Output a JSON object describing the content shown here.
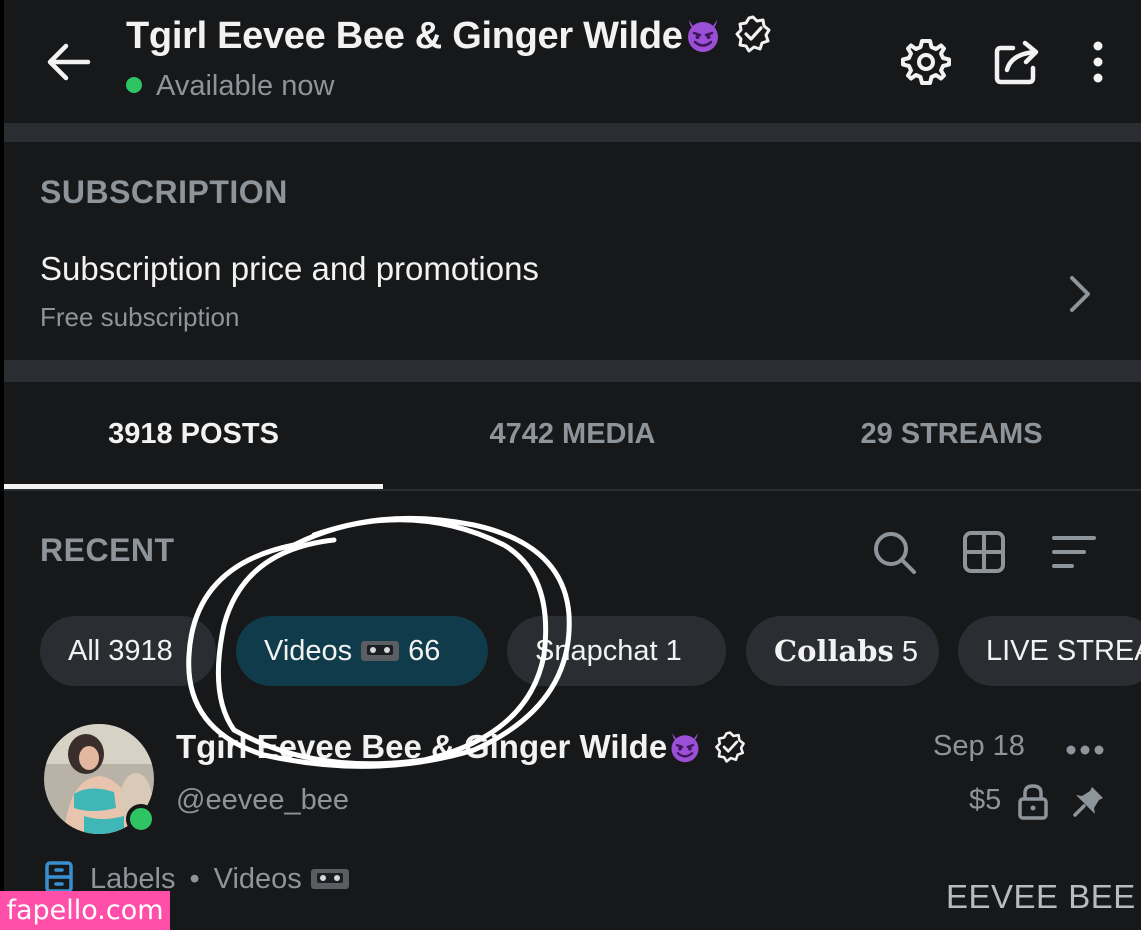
{
  "header": {
    "title": "Tgirl Eevee Bee & Ginger Wilde",
    "status": "Available now",
    "icons": [
      "back-arrow-icon",
      "devil-emoji-icon",
      "verified-badge-icon",
      "settings-gear-icon",
      "share-icon",
      "more-vertical-icon"
    ]
  },
  "subscription": {
    "heading": "SUBSCRIPTION",
    "price_label": "Subscription price and promotions",
    "price_value": "Free subscription"
  },
  "tabs": [
    {
      "label": "3918 POSTS",
      "active": true
    },
    {
      "label": "4742 MEDIA",
      "active": false
    },
    {
      "label": "29 STREAMS",
      "active": false
    }
  ],
  "recent": {
    "heading": "RECENT",
    "icons": [
      "search-icon",
      "grid-icon",
      "sort-icon"
    ]
  },
  "chips": [
    {
      "label": "All 3918",
      "active": false
    },
    {
      "label": "Videos",
      "count": "66",
      "active": true
    },
    {
      "label": "Snapchat 1",
      "active": false
    },
    {
      "label": "Collabs",
      "count": "5",
      "active": false
    },
    {
      "label": "LIVE STREA",
      "active": false
    }
  ],
  "post": {
    "name": "Tgirl Eevee Bee & Ginger Wilde",
    "handle": "@eevee_bee",
    "date": "Sep 18",
    "price": "$5",
    "labels_label": "Labels",
    "labels_value": "Videos"
  },
  "watermarks": {
    "bottom_right": "EEVEE BEE",
    "bottom_left": "fapello.com"
  },
  "colors": {
    "background": "#17181a",
    "separator": "#2a2d31",
    "text_primary": "#f2f2f2",
    "text_secondary": "#8d949a",
    "online_green": "#2fc463",
    "active_chip": "#0f3b4a",
    "watermark_pink": "#ff4fa8"
  }
}
